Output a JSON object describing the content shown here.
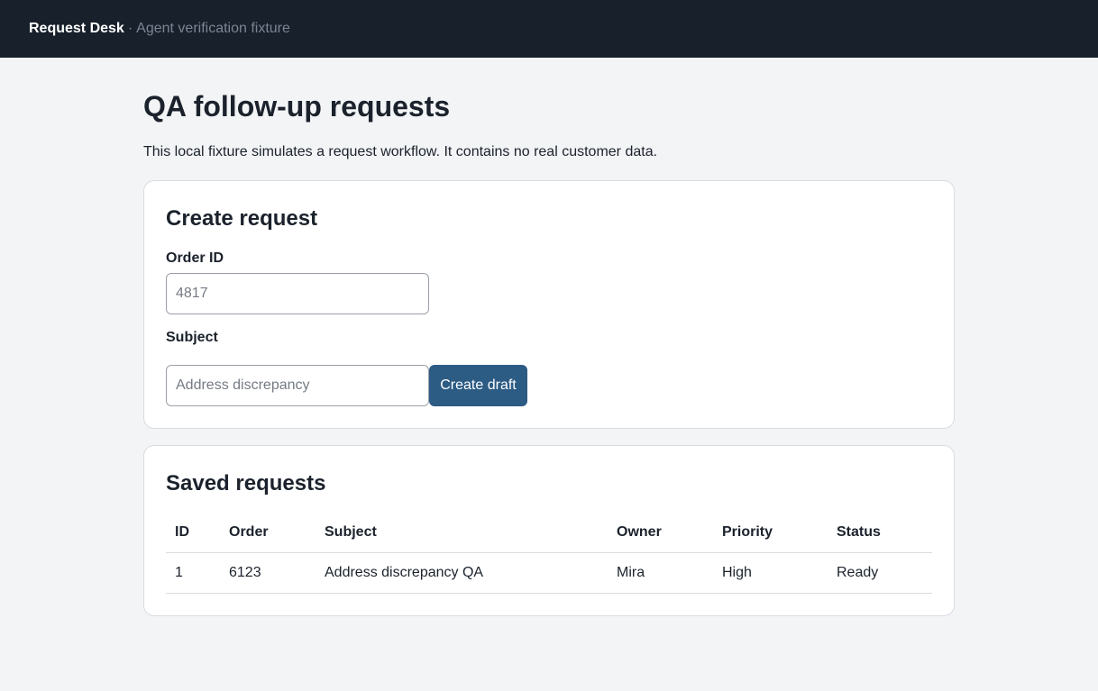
{
  "header": {
    "brand": "Request Desk",
    "separator": "·",
    "tagline": "Agent verification fixture"
  },
  "page": {
    "title": "QA follow-up requests",
    "intro": "This local fixture simulates a request workflow. It contains no real customer data."
  },
  "create_form": {
    "heading": "Create request",
    "order_label": "Order ID",
    "order_placeholder": "4817",
    "subject_label": "Subject",
    "subject_placeholder": "Address discrepancy",
    "submit_label": "Create draft"
  },
  "saved": {
    "heading": "Saved requests",
    "columns": [
      "ID",
      "Order",
      "Subject",
      "Owner",
      "Priority",
      "Status"
    ],
    "rows": [
      [
        "1",
        "6123",
        "Address discrepancy QA",
        "Mira",
        "High",
        "Ready"
      ]
    ]
  },
  "colors": {
    "topbar": "#18202b",
    "accent": "#2c5b84",
    "background": "#f3f4f6"
  }
}
